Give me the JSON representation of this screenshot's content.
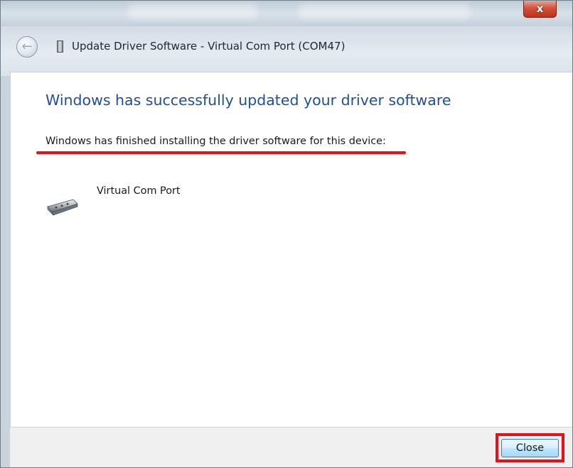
{
  "window": {
    "title": "Update Driver Software - Virtual Com Port (COM47)",
    "close_glyph": "x"
  },
  "nav": {
    "back_icon": "back-arrow-icon",
    "back_glyph": "←"
  },
  "content": {
    "heading": "Windows has successfully updated your driver software",
    "message": "Windows has finished installing the driver software for this device:",
    "device_icon": "usb-serial-port-icon",
    "device_name": "Virtual Com Port"
  },
  "footer": {
    "close_label": "Close"
  },
  "colors": {
    "heading": "#1f4e9c",
    "annotation_red": "#e0121a",
    "footer_bg": "#f0f0f0"
  }
}
